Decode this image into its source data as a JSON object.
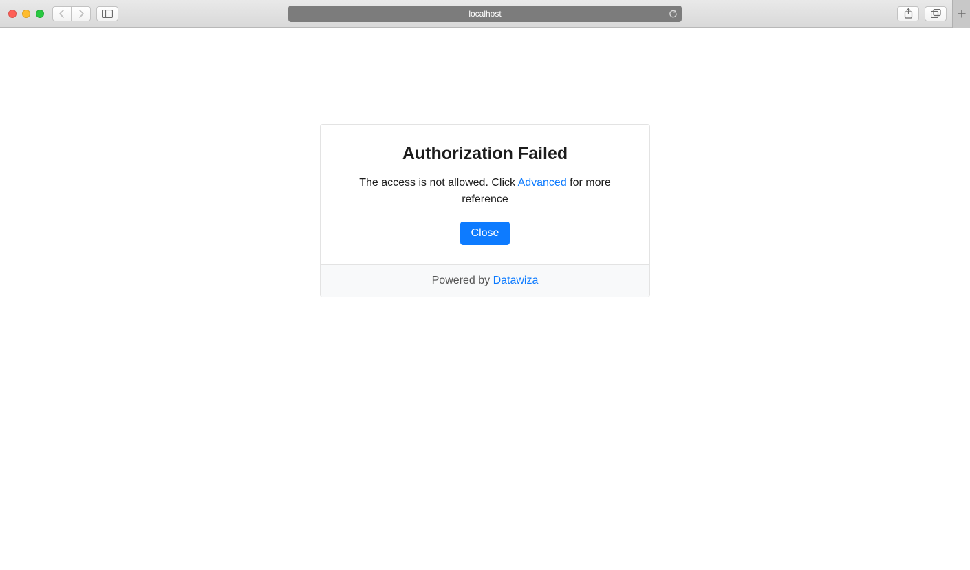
{
  "browser": {
    "url": "localhost"
  },
  "dialog": {
    "title": "Authorization Failed",
    "message_before": "The access is not allowed. Click ",
    "advanced_link": "Advanced",
    "message_after": " for more reference",
    "close_button": "Close"
  },
  "footer": {
    "prefix": "Powered by ",
    "brand": "Datawiza"
  }
}
